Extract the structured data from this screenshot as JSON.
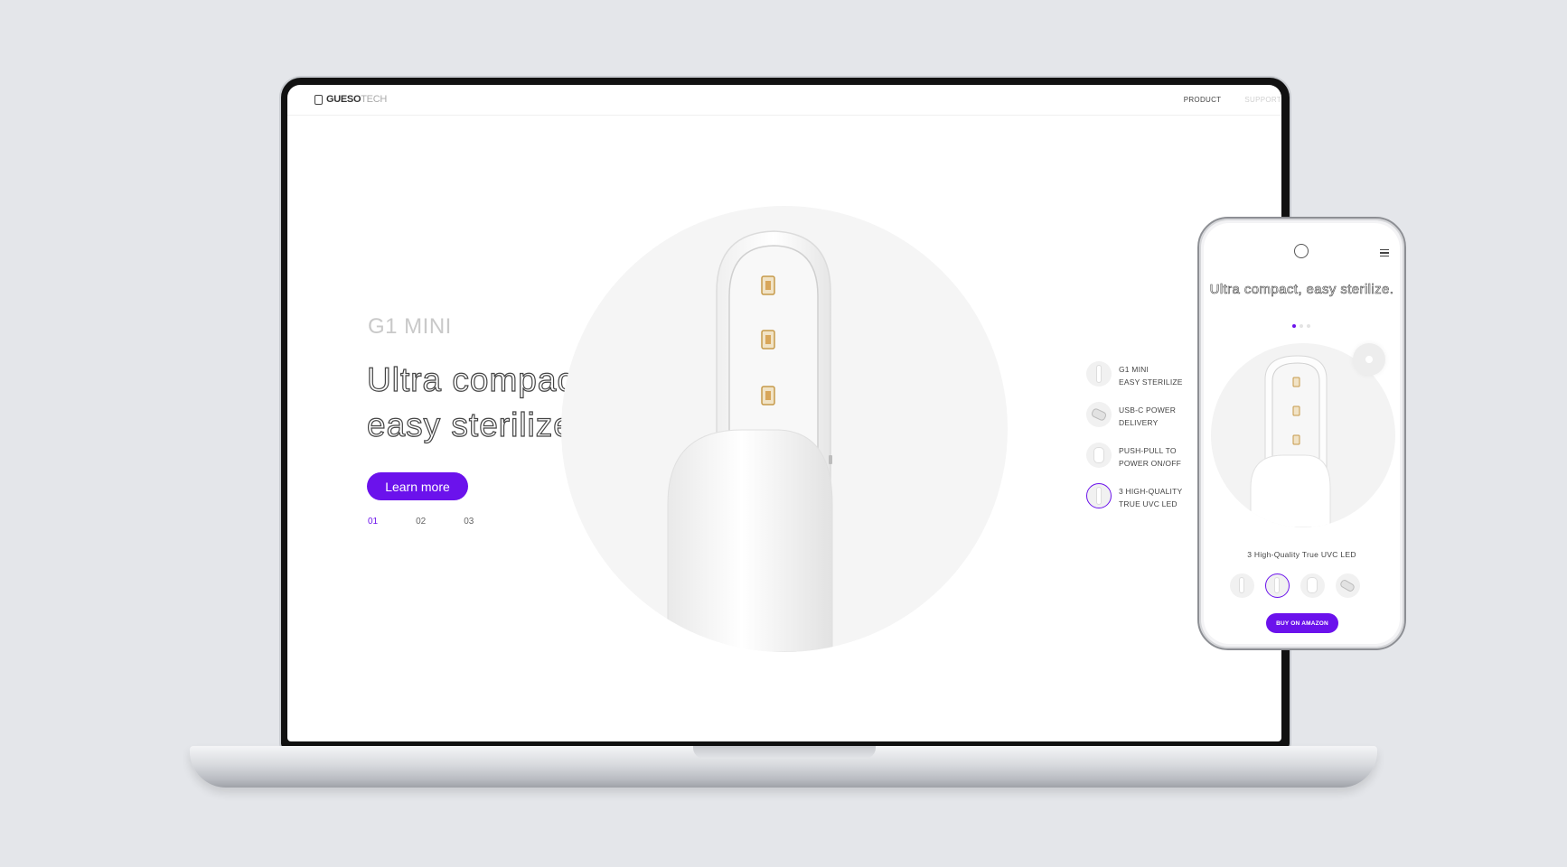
{
  "laptop": {
    "header": {
      "logo_bold": "GUESO",
      "logo_light": "TECH",
      "nav": [
        {
          "label": "PRODUCT"
        },
        {
          "label": "SUPPORT"
        }
      ]
    },
    "hero": {
      "subtitle": "G1 MINI",
      "title": "Ultra compact, easy sterilize.",
      "cta_label": "Learn more",
      "pager": [
        {
          "label": "01",
          "active": true
        },
        {
          "label": "02",
          "active": false
        },
        {
          "label": "03",
          "active": false
        }
      ]
    },
    "features": [
      {
        "line1": "G1 MINI",
        "line2": "EASY STERILIZE",
        "active": false
      },
      {
        "line1": "USB-C POWER",
        "line2": "DELIVERY",
        "active": false
      },
      {
        "line1": "PUSH-PULL TO",
        "line2": "POWER ON/OFF",
        "active": false
      },
      {
        "line1": "3 HIGH-QUALITY",
        "line2": "TRUE UVC LED",
        "active": true
      }
    ]
  },
  "phone": {
    "title": "Ultra compact, easy sterilize.",
    "caption": "3 High-Quality True UVC LED",
    "buy_label": "BUY ON AMAZON",
    "active_thumb": 2
  },
  "colors": {
    "accent": "#6b12ec",
    "background": "#e4e6ea"
  },
  "icons": [
    "gueso-logo-icon",
    "menu-icon",
    "uvc-led-icon"
  ]
}
